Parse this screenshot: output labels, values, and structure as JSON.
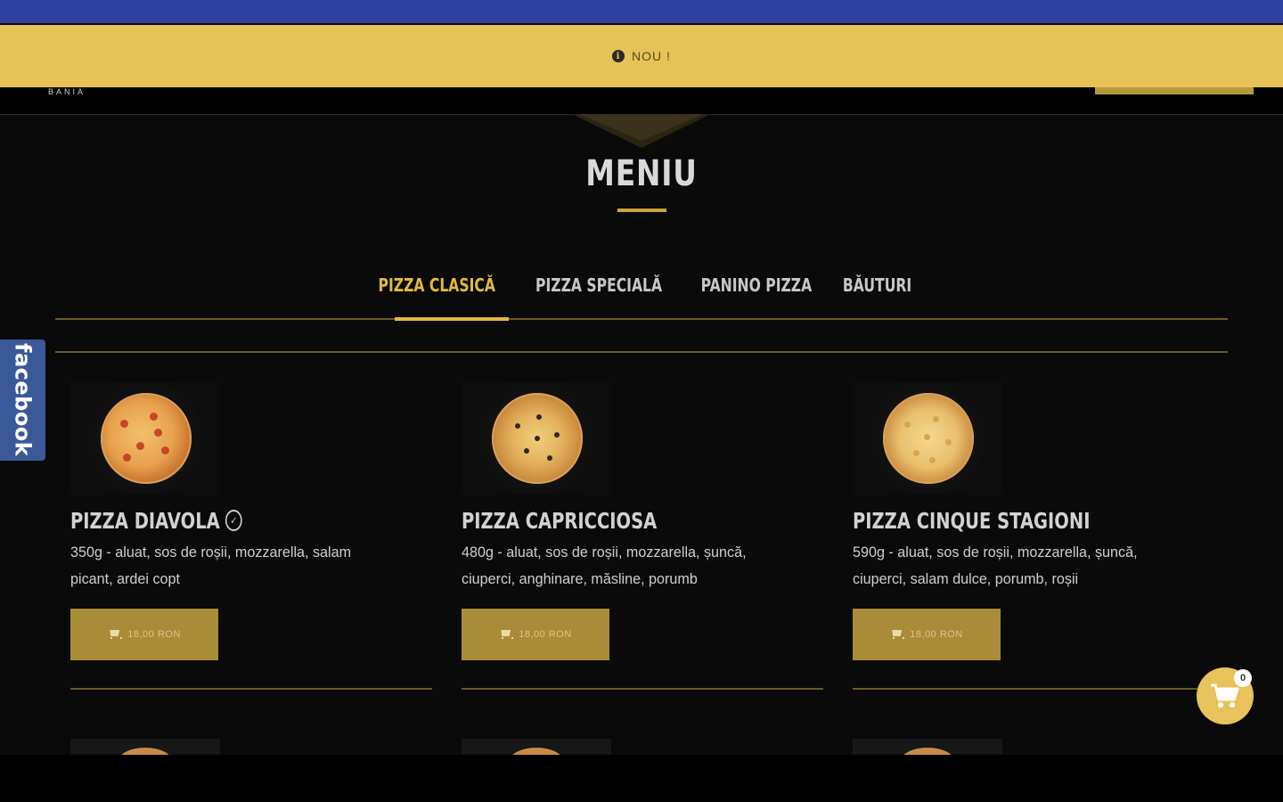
{
  "notice": {
    "icon": "info-icon",
    "text": "NOU !"
  },
  "header": {
    "logo_text": "BANIA"
  },
  "section": {
    "title": "MENIU"
  },
  "tabs": [
    {
      "label": "PIZZA CLASICĂ",
      "active": true
    },
    {
      "label": "PIZZA SPECIALĂ",
      "active": false
    },
    {
      "label": "PANINO PIZZA",
      "active": false
    },
    {
      "label": "BĂUTURI",
      "active": false
    }
  ],
  "facebook": {
    "label": "facebook"
  },
  "products": [
    {
      "name": "PIZZA DIAVOLA",
      "spicy": true,
      "desc_line1": "350g - aluat, sos de roșii, mozzarella, salam",
      "desc_line2": "picant, ardei copt",
      "price": "18,00 RON"
    },
    {
      "name": "PIZZA CAPRICCIOSA",
      "spicy": false,
      "desc_line1": "480g - aluat, sos de roșii, mozzarella, șuncă,",
      "desc_line2": "ciuperci, anghinare, măsline, porumb",
      "price": "18,00 RON"
    },
    {
      "name": "PIZZA CINQUE STAGIONI",
      "spicy": false,
      "desc_line1": "590g - aluat, sos de roșii, mozzarella, șuncă,",
      "desc_line2": "ciuperci, salam dulce, porumb, roșii",
      "price": "18,00 RON"
    }
  ],
  "cart": {
    "count": "0",
    "icon": "shopping-cart-icon"
  },
  "colors": {
    "accent": "#e2b93e",
    "notice_bg": "#e6c257",
    "top_strip": "#2e3f9e",
    "button_bg": "#a88c38",
    "facebook": "#3b5998"
  }
}
